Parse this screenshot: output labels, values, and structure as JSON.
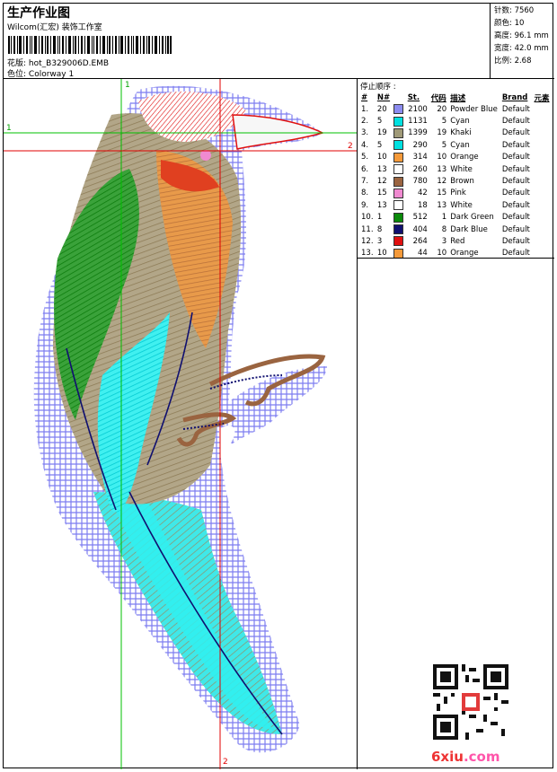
{
  "header": {
    "title": "生产作业图",
    "company": "Wilcom(汇宏) 装饰工作室",
    "design_label": "花版:",
    "design_value": "hot_B329006D.EMB",
    "colorway_label": "色位:",
    "colorway_value": "Colorway 1"
  },
  "stats": {
    "stitches": "针数: 7560",
    "colors": "颜色: 10",
    "height": "高度: 96.1 mm",
    "width": "宽度: 42.0 mm",
    "ratio": "比例: 2.68"
  },
  "canvas": {
    "axis_green_v": "1",
    "axis_green_h": "1",
    "axis_red_h": "2",
    "axis_red_v": "2"
  },
  "stop_sequence": {
    "title": "停止顺序 :",
    "headers": [
      "#",
      "N#",
      "St.",
      "代码",
      "描述",
      "Brand",
      "元素"
    ],
    "rows": [
      {
        "idx": "1.",
        "n": "20",
        "color": "#8c8cf0",
        "st": "2100",
        "code": "20",
        "desc": "Powder Blue",
        "brand": "Default"
      },
      {
        "idx": "2.",
        "n": "5",
        "color": "#00e0e0",
        "st": "1131",
        "code": "5",
        "desc": "Cyan",
        "brand": "Default"
      },
      {
        "idx": "3.",
        "n": "19",
        "color": "#a09a78",
        "st": "1399",
        "code": "19",
        "desc": "Khaki",
        "brand": "Default"
      },
      {
        "idx": "4.",
        "n": "5",
        "color": "#00e0e0",
        "st": "290",
        "code": "5",
        "desc": "Cyan",
        "brand": "Default"
      },
      {
        "idx": "5.",
        "n": "10",
        "color": "#f59a3a",
        "st": "314",
        "code": "10",
        "desc": "Orange",
        "brand": "Default"
      },
      {
        "idx": "6.",
        "n": "13",
        "color": "#ffffff",
        "st": "260",
        "code": "13",
        "desc": "White",
        "brand": "Default"
      },
      {
        "idx": "7.",
        "n": "12",
        "color": "#9a6440",
        "st": "780",
        "code": "12",
        "desc": "Brown",
        "brand": "Default"
      },
      {
        "idx": "8.",
        "n": "15",
        "color": "#f08ad0",
        "st": "42",
        "code": "15",
        "desc": "Pink",
        "brand": "Default"
      },
      {
        "idx": "9.",
        "n": "13",
        "color": "#ffffff",
        "st": "18",
        "code": "13",
        "desc": "White",
        "brand": "Default"
      },
      {
        "idx": "10.",
        "n": "1",
        "color": "#0a8a0a",
        "st": "512",
        "code": "1",
        "desc": "Dark Green",
        "brand": "Default"
      },
      {
        "idx": "11.",
        "n": "8",
        "color": "#101070",
        "st": "404",
        "code": "8",
        "desc": "Dark Blue",
        "brand": "Default"
      },
      {
        "idx": "12.",
        "n": "3",
        "color": "#e01010",
        "st": "264",
        "code": "3",
        "desc": "Red",
        "brand": "Default"
      },
      {
        "idx": "13.",
        "n": "10",
        "color": "#f59a3a",
        "st": "44",
        "code": "10",
        "desc": "Orange",
        "brand": "Default"
      }
    ]
  },
  "watermark": {
    "main": "6xiu",
    "suffix": ".com"
  }
}
